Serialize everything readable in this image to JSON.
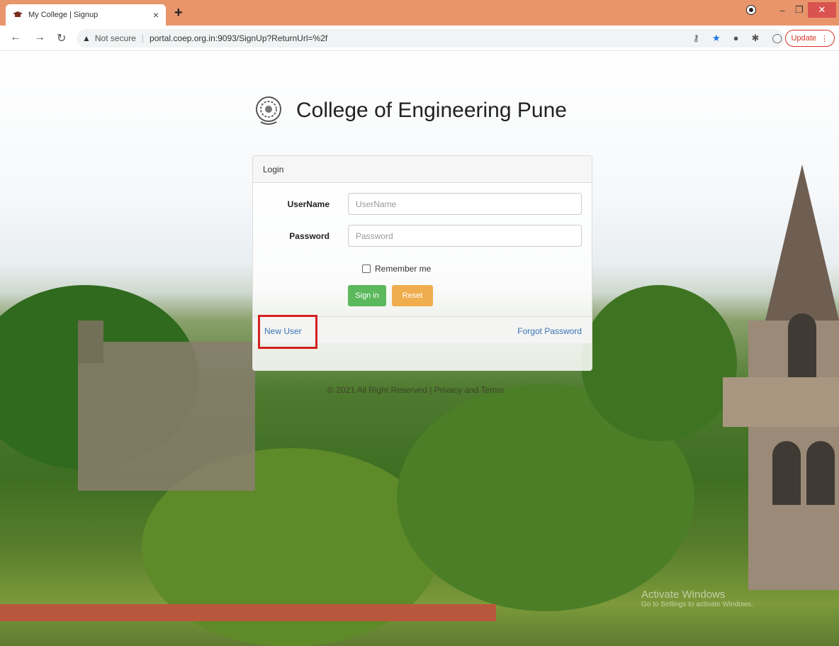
{
  "browser": {
    "tab_title": "My College | Signup",
    "tab_close": "×",
    "new_tab": "+",
    "security_label": "Not secure",
    "url": "portal.coep.org.in:9093/SignUp?ReturnUrl=%2f",
    "update_label": "Update",
    "controls": {
      "minimize": "–",
      "restore": "❐",
      "close": "✕"
    }
  },
  "page": {
    "college_name": "College of Engineering Pune",
    "login": {
      "heading": "Login",
      "username_label": "UserName",
      "username_placeholder": "UserName",
      "username_value": "",
      "password_label": "Password",
      "password_placeholder": "Password",
      "password_value": "",
      "remember_label": "Remember me",
      "remember_checked": false,
      "signin_label": "Sign in",
      "reset_label": "Reset",
      "new_user_label": "New User",
      "forgot_label": "Forgot Password"
    },
    "copyright": "© 2021 All Right Reserved | Privacy and Terms",
    "watermark_title": "Activate Windows",
    "watermark_sub": "Go to Settings to activate Windows."
  },
  "colors": {
    "tab_bar": "#e8956b",
    "signin": "#5cb85c",
    "reset": "#f0ad4e",
    "link": "#3a74b5",
    "highlight": "#d42020"
  }
}
